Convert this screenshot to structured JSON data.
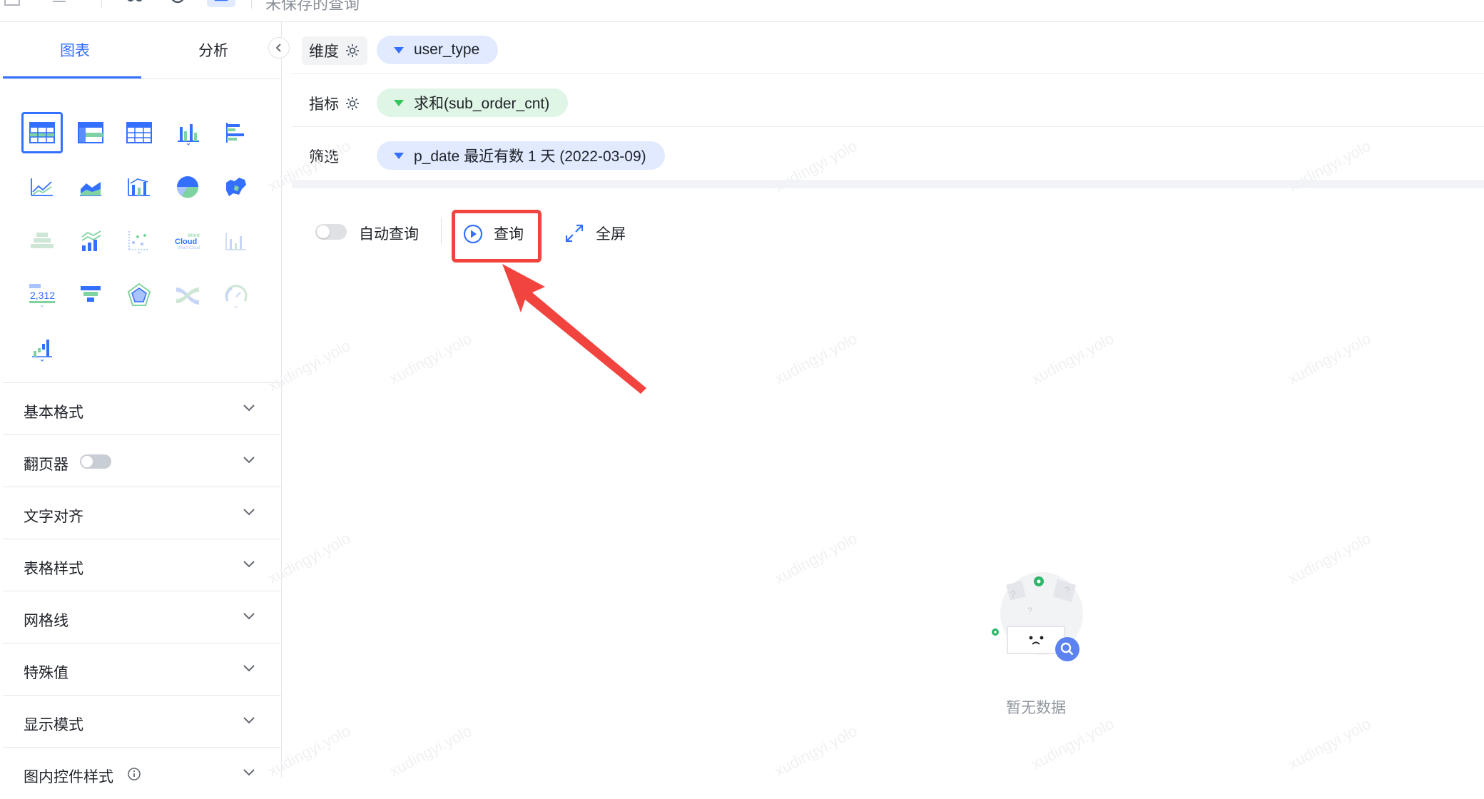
{
  "toolbar": {
    "title": "未保存的查询"
  },
  "left_panel": {
    "tabs": [
      {
        "label": "图表",
        "active": true
      },
      {
        "label": "分析",
        "active": false
      }
    ],
    "chart_types": [
      "table-chart-icon",
      "pivot-table-icon",
      "detail-table-icon",
      "column-chart-icon",
      "bar-chart-icon",
      "line-chart-icon",
      "area-chart-icon",
      "combo-chart-icon",
      "pie-chart-icon",
      "map-chart-icon",
      "stacked-chart-icon",
      "line-column-chart-icon",
      "scatter-chart-icon",
      "word-cloud-icon",
      "histogram-chart-icon",
      "indicator-card-icon",
      "funnel-chart-icon",
      "radar-chart-icon",
      "sankey-chart-icon",
      "gauge-chart-icon",
      "waterfall-chart-icon"
    ],
    "sections": [
      {
        "label": "基本格式"
      },
      {
        "label": "翻页器",
        "toggle": true
      },
      {
        "label": "文字对齐"
      },
      {
        "label": "表格样式"
      },
      {
        "label": "网格线"
      },
      {
        "label": "特殊值"
      },
      {
        "label": "显示模式"
      },
      {
        "label": "图内控件样式",
        "info": true
      }
    ]
  },
  "config": {
    "dimension": {
      "label": "维度",
      "value": "user_type"
    },
    "metric": {
      "label": "指标",
      "value": "求和(sub_order_cnt)"
    },
    "filter": {
      "label": "筛选",
      "value": "p_date 最近有数 1 天 (2022-03-09)"
    }
  },
  "query_bar": {
    "auto_query_label": "自动查询",
    "auto_query_on": false,
    "query_label": "查询",
    "fullscreen_label": "全屏"
  },
  "empty_state": {
    "text": "暂无数据"
  },
  "watermark": "xudingyi.yolo",
  "colors": {
    "accent": "#3370ff",
    "highlight": "#f2443f",
    "metric_pill": "#dff5e5",
    "dim_pill": "#e1eaff"
  }
}
